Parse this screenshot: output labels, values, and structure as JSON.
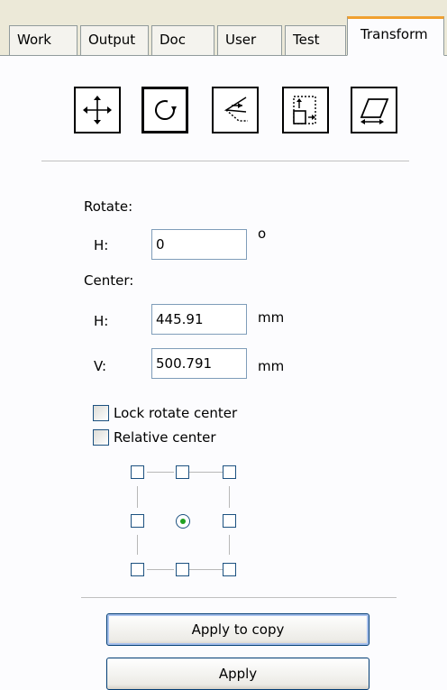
{
  "tabs": [
    {
      "label": "Work"
    },
    {
      "label": "Output"
    },
    {
      "label": "Doc"
    },
    {
      "label": "User"
    },
    {
      "label": "Test"
    },
    {
      "label": "Transform"
    }
  ],
  "active_tab": "Transform",
  "mode_buttons": [
    {
      "icon": "move-icon"
    },
    {
      "icon": "rotate-icon",
      "selected": true
    },
    {
      "icon": "mirror-icon"
    },
    {
      "icon": "scale-icon"
    },
    {
      "icon": "skew-icon"
    }
  ],
  "rotate": {
    "section_label": "Rotate:",
    "h_label": "H:",
    "h_value": "0",
    "unit": "o"
  },
  "center": {
    "section_label": "Center:",
    "h_label": "H:",
    "h_value": "445.91",
    "h_unit": "mm",
    "v_label": "V:",
    "v_value": "500.791",
    "v_unit": "mm"
  },
  "options": {
    "lock_rotate_center": {
      "label": "Lock rotate center",
      "checked": false
    },
    "relative_center": {
      "label": "Relative center",
      "checked": false
    }
  },
  "anchor_grid": {
    "selected": "middle-center"
  },
  "buttons": {
    "apply_to_copy": "Apply to copy",
    "apply": "Apply"
  }
}
